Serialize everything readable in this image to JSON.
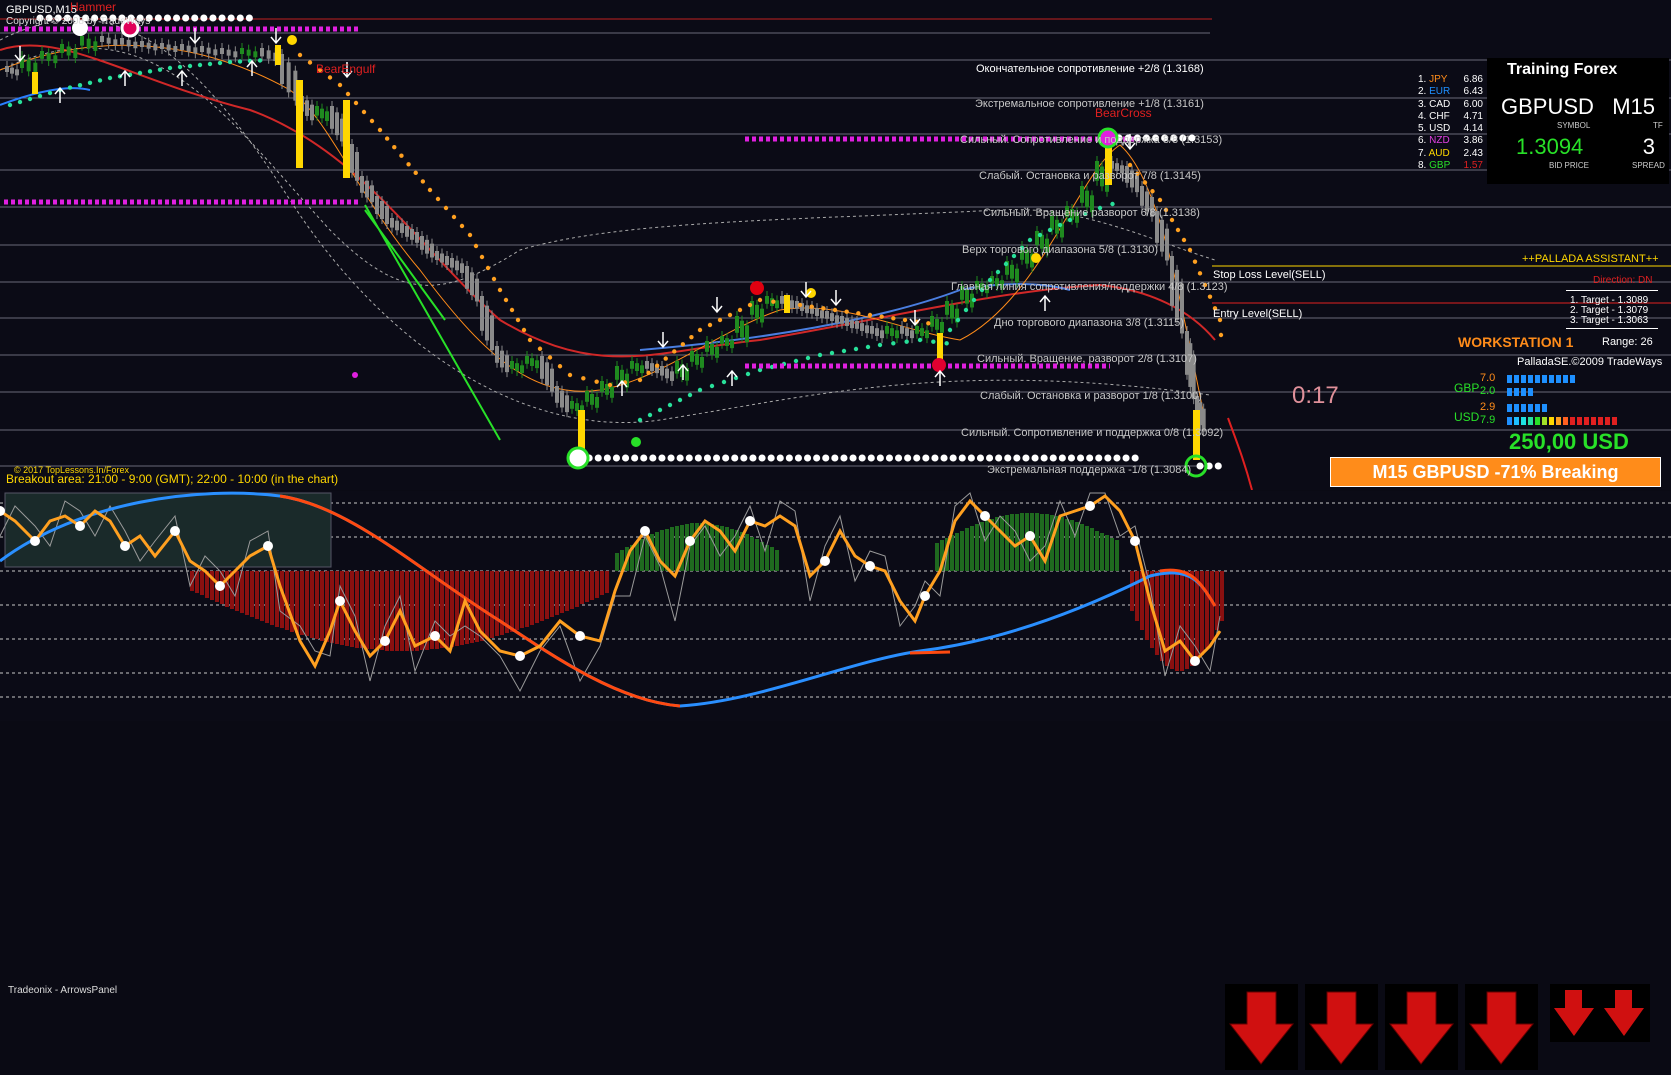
{
  "chart": {
    "symbol_label": "GBPUSD,M15",
    "copyright_top": "Copyright © 2008 by TradeWays",
    "patterns": {
      "hammer": "Hammer",
      "bear_engulf": "BearEngulf",
      "bear_cross": "BearCross"
    },
    "levels": [
      {
        "text": "Окончательное сопротивление +2/8  (1.3168)",
        "bright": true
      },
      {
        "text": "Экстремальное сопротивление +1/8  (1.3161)",
        "bright": false
      },
      {
        "text": "Сильный. Сопротивление и поддержка 8/8  (1.3153)",
        "bright": false
      },
      {
        "text": "Слабый. Остановка и разворот 7/8  (1.3145)",
        "bright": false
      },
      {
        "text": "Сильный. Вращение разворот 6/8  (1.3138)",
        "bright": false
      },
      {
        "text": "Верх торгового диапазона 5/8  (1.3130)",
        "bright": false
      },
      {
        "text": "Главная линия сопротивления/поддержки 4/8  (1.3123)",
        "bright": false
      },
      {
        "text": "Дно торгового диапазона 3/8  (1.3115)",
        "bright": false
      },
      {
        "text": "Сильный. Вращение, разворот 2/8  (1.3107)",
        "bright": false
      },
      {
        "text": "Слабый. Остановка и разворот 1/8  (1.3100)",
        "bright": false
      },
      {
        "text": "Сильный. Сопротивление и поддержка 0/8  (1.3092)",
        "bright": false
      },
      {
        "text": "Экстремальная поддержка -1/8  (1.3084)",
        "bright": false
      }
    ],
    "stop_loss_label": "Stop Loss Level(SELL)",
    "entry_label": "Entry Level(SELL)",
    "copyright_bottom": "© 2017 TopLessons.In/Forex",
    "breakout_text": "Breakout area: 21:00 - 9:00 (GMT); 22:00 - 10:00 (in the chart)",
    "timer": "0:17"
  },
  "currency_strength": [
    {
      "rank": "1.",
      "name": "JPY",
      "value": "6.86",
      "color": "#ff8c1a"
    },
    {
      "rank": "2.",
      "name": "EUR",
      "value": "6.43",
      "color": "#1e90ff"
    },
    {
      "rank": "3.",
      "name": "CAD",
      "value": "6.00",
      "color": "#ffffff"
    },
    {
      "rank": "4.",
      "name": "CHF",
      "value": "4.71",
      "color": "#ffffff"
    },
    {
      "rank": "5.",
      "name": "USD",
      "value": "4.14",
      "color": "#ffffff"
    },
    {
      "rank": "6.",
      "name": "NZD",
      "value": "3.86",
      "color": "#e040e0"
    },
    {
      "rank": "7.",
      "name": "AUD",
      "value": "2.43",
      "color": "#ffd700"
    },
    {
      "rank": "8.",
      "name": "GBP",
      "value": "1.57",
      "color": "#28e028",
      "value_color": "#e02020"
    }
  ],
  "info_panel": {
    "title": "Training Forex",
    "symbol": "GBPUSD",
    "symbol_caption": "SYMBOL",
    "timeframe": "M15",
    "timeframe_caption": "TF",
    "bid": "1.3094",
    "bid_caption": "BID PRICE",
    "spread": "3",
    "spread_caption": "SPREAD"
  },
  "assistant": {
    "title": "++PALLADA ASSISTANT++",
    "direction": "Direction: DN",
    "targets": [
      "1. Target - 1.3089",
      "2. Target - 1.3079",
      "3. Target - 1.3063"
    ],
    "workstation": "WORKSTATION 1",
    "range": "Range: 26",
    "palladase": "PalladaSE.©2009 TradeWays",
    "gbp_label": "GBP",
    "gbp_values": [
      "7.0",
      "2.0"
    ],
    "usd_label": "USD",
    "usd_values": [
      "2.9",
      "7.9"
    ],
    "profit": "250,00 USD",
    "banner": "M15 GBPUSD  -71% Breaking"
  },
  "oscillator": {
    "panel_label": "Tradeonix - ArrowsPanel"
  },
  "colors": {
    "background": "#0b0b16",
    "accent_orange": "#ff8c1a",
    "bull_green": "#28e028",
    "bear_red": "#e02020",
    "magenta": "#e020e0"
  }
}
